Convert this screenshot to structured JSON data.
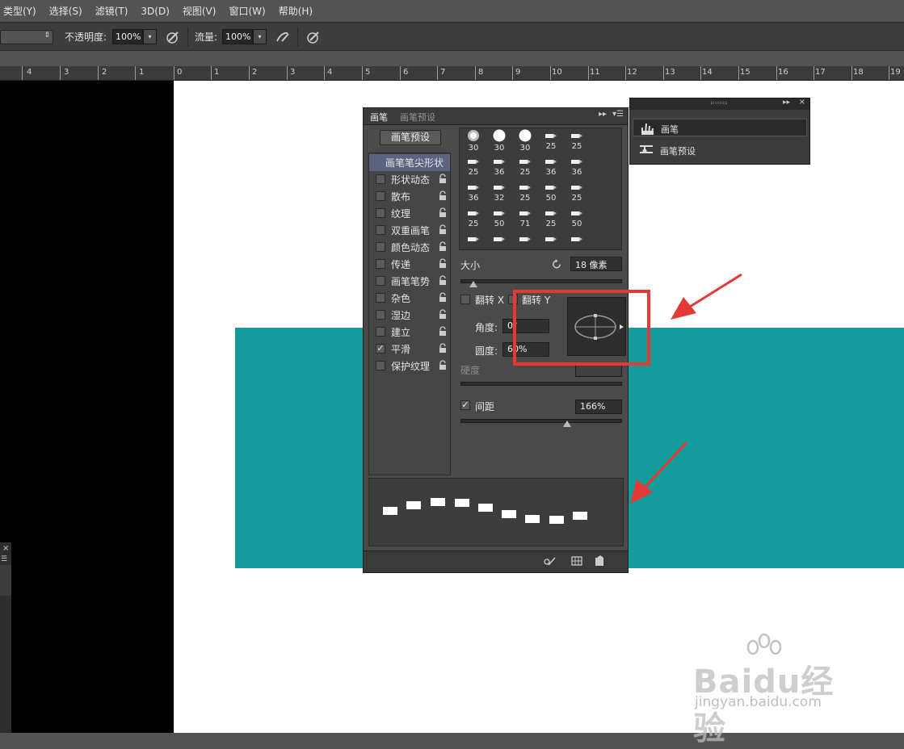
{
  "menubar": {
    "items": [
      "类型(Y)",
      "选择(S)",
      "滤镜(T)",
      "3D(D)",
      "视图(V)",
      "窗口(W)",
      "帮助(H)"
    ]
  },
  "options": {
    "opacity_label": "不透明度:",
    "opacity_value": "100%",
    "flow_label": "流量:",
    "flow_value": "100%"
  },
  "ruler": {
    "ticks": [
      "4",
      "3",
      "2",
      "1",
      "0",
      "1",
      "2",
      "3",
      "4",
      "5",
      "6",
      "7",
      "8",
      "9",
      "10",
      "11",
      "12",
      "13",
      "14",
      "15",
      "16",
      "17",
      "18",
      "19"
    ]
  },
  "brush_panel": {
    "tabs": [
      "画笔",
      "画笔预设"
    ],
    "preset_button": "画笔预设",
    "options": [
      {
        "label": "画笔笔尖形状",
        "checked": false,
        "active": true
      },
      {
        "label": "形状动态",
        "checked": false
      },
      {
        "label": "散布",
        "checked": false
      },
      {
        "label": "纹理",
        "checked": false
      },
      {
        "label": "双重画笔",
        "checked": false
      },
      {
        "label": "颜色动态",
        "checked": false
      },
      {
        "label": "传递",
        "checked": false
      },
      {
        "label": "画笔笔势",
        "checked": false
      },
      {
        "label": "杂色",
        "checked": false
      },
      {
        "label": "湿边",
        "checked": false
      },
      {
        "label": "建立",
        "checked": false
      },
      {
        "label": "平滑",
        "checked": true
      },
      {
        "label": "保护纹理",
        "checked": false
      }
    ],
    "tip_sizes": [
      [
        "30",
        "30",
        "30",
        "25",
        "25"
      ],
      [
        "25",
        "36",
        "25",
        "36",
        "36"
      ],
      [
        "36",
        "32",
        "25",
        "50",
        "25"
      ],
      [
        "25",
        "50",
        "71",
        "25",
        "50"
      ],
      [
        "",
        "",
        "",
        "",
        ""
      ]
    ],
    "size_label": "大小",
    "size_value": "18 像素",
    "flip_x_label": "翻转 X",
    "flip_y_label": "翻转 Y",
    "angle_label": "角度:",
    "angle_value": "0°",
    "roundness_label": "圆度:",
    "roundness_value": "60%",
    "hardness_label": "硬度",
    "spacing_label": "间距",
    "spacing_checked": true,
    "spacing_value": "166%",
    "size_slider_fraction": 0.08,
    "spacing_slider_fraction": 0.66
  },
  "presets_panel": {
    "items": [
      {
        "label": "画笔",
        "icon": "brush-icon",
        "selected": true
      },
      {
        "label": "画笔预设",
        "icon": "brush-preset-icon",
        "selected": false
      }
    ]
  },
  "watermark": {
    "logo": "Baidu经验",
    "url": "jingyan.baidu.com"
  },
  "colors": {
    "teal": "#159b9b",
    "highlight": "#e53935",
    "panel": "#4a4a4a"
  }
}
